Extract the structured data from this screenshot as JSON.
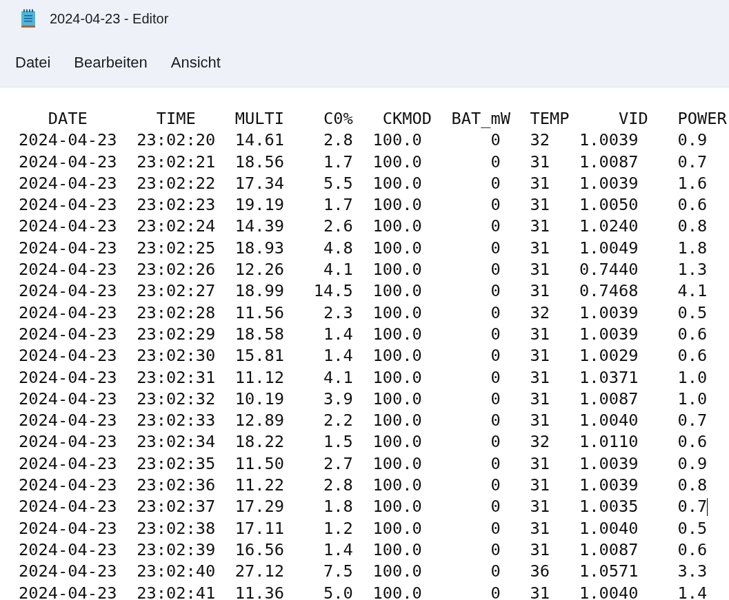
{
  "window": {
    "title": "2024-04-23 - Editor"
  },
  "menu": [
    "Datei",
    "Bearbeiten",
    "Ansicht"
  ],
  "lines": [
    {
      "text": "   DATE       TIME    MULTI    C0%   CKMOD  BAT_mW  TEMP     VID   POWER",
      "caret": false
    },
    {
      "text": "2024-04-23  23:02:20  14.61    2.8  100.0       0   32   1.0039    0.9",
      "caret": false
    },
    {
      "text": "2024-04-23  23:02:21  18.56    1.7  100.0       0   31   1.0087    0.7",
      "caret": false
    },
    {
      "text": "2024-04-23  23:02:22  17.34    5.5  100.0       0   31   1.0039    1.6",
      "caret": false
    },
    {
      "text": "2024-04-23  23:02:23  19.19    1.7  100.0       0   31   1.0050    0.6",
      "caret": false
    },
    {
      "text": "2024-04-23  23:02:24  14.39    2.6  100.0       0   31   1.0240    0.8",
      "caret": false
    },
    {
      "text": "2024-04-23  23:02:25  18.93    4.8  100.0       0   31   1.0049    1.8",
      "caret": false
    },
    {
      "text": "2024-04-23  23:02:26  12.26    4.1  100.0       0   31   0.7440    1.3",
      "caret": false
    },
    {
      "text": "2024-04-23  23:02:27  18.99   14.5  100.0       0   31   0.7468    4.1",
      "caret": false
    },
    {
      "text": "2024-04-23  23:02:28  11.56    2.3  100.0       0   32   1.0039    0.5",
      "caret": false
    },
    {
      "text": "2024-04-23  23:02:29  18.58    1.4  100.0       0   31   1.0039    0.6",
      "caret": false
    },
    {
      "text": "2024-04-23  23:02:30  15.81    1.4  100.0       0   31   1.0029    0.6",
      "caret": false
    },
    {
      "text": "2024-04-23  23:02:31  11.12    4.1  100.0       0   31   1.0371    1.0",
      "caret": false
    },
    {
      "text": "2024-04-23  23:02:32  10.19    3.9  100.0       0   31   1.0087    1.0",
      "caret": false
    },
    {
      "text": "2024-04-23  23:02:33  12.89    2.2  100.0       0   31   1.0040    0.7",
      "caret": false
    },
    {
      "text": "2024-04-23  23:02:34  18.22    1.5  100.0       0   32   1.0110    0.6",
      "caret": false
    },
    {
      "text": "2024-04-23  23:02:35  11.50    2.7  100.0       0   31   1.0039    0.9",
      "caret": false
    },
    {
      "text": "2024-04-23  23:02:36  11.22    2.8  100.0       0   31   1.0039    0.8",
      "caret": false
    },
    {
      "text": "2024-04-23  23:02:37  17.29    1.8  100.0       0   31   1.0035    0.7",
      "caret": true
    },
    {
      "text": "2024-04-23  23:02:38  17.11    1.2  100.0       0   31   1.0040    0.5",
      "caret": false
    },
    {
      "text": "2024-04-23  23:02:39  16.56    1.4  100.0       0   31   1.0087    0.6",
      "caret": false
    },
    {
      "text": "2024-04-23  23:02:40  27.12    7.5  100.0       0   36   1.0571    3.3",
      "caret": false
    },
    {
      "text": "2024-04-23  23:02:41  11.36    5.0  100.0       0   31   1.0040    1.4",
      "caret": false
    }
  ]
}
